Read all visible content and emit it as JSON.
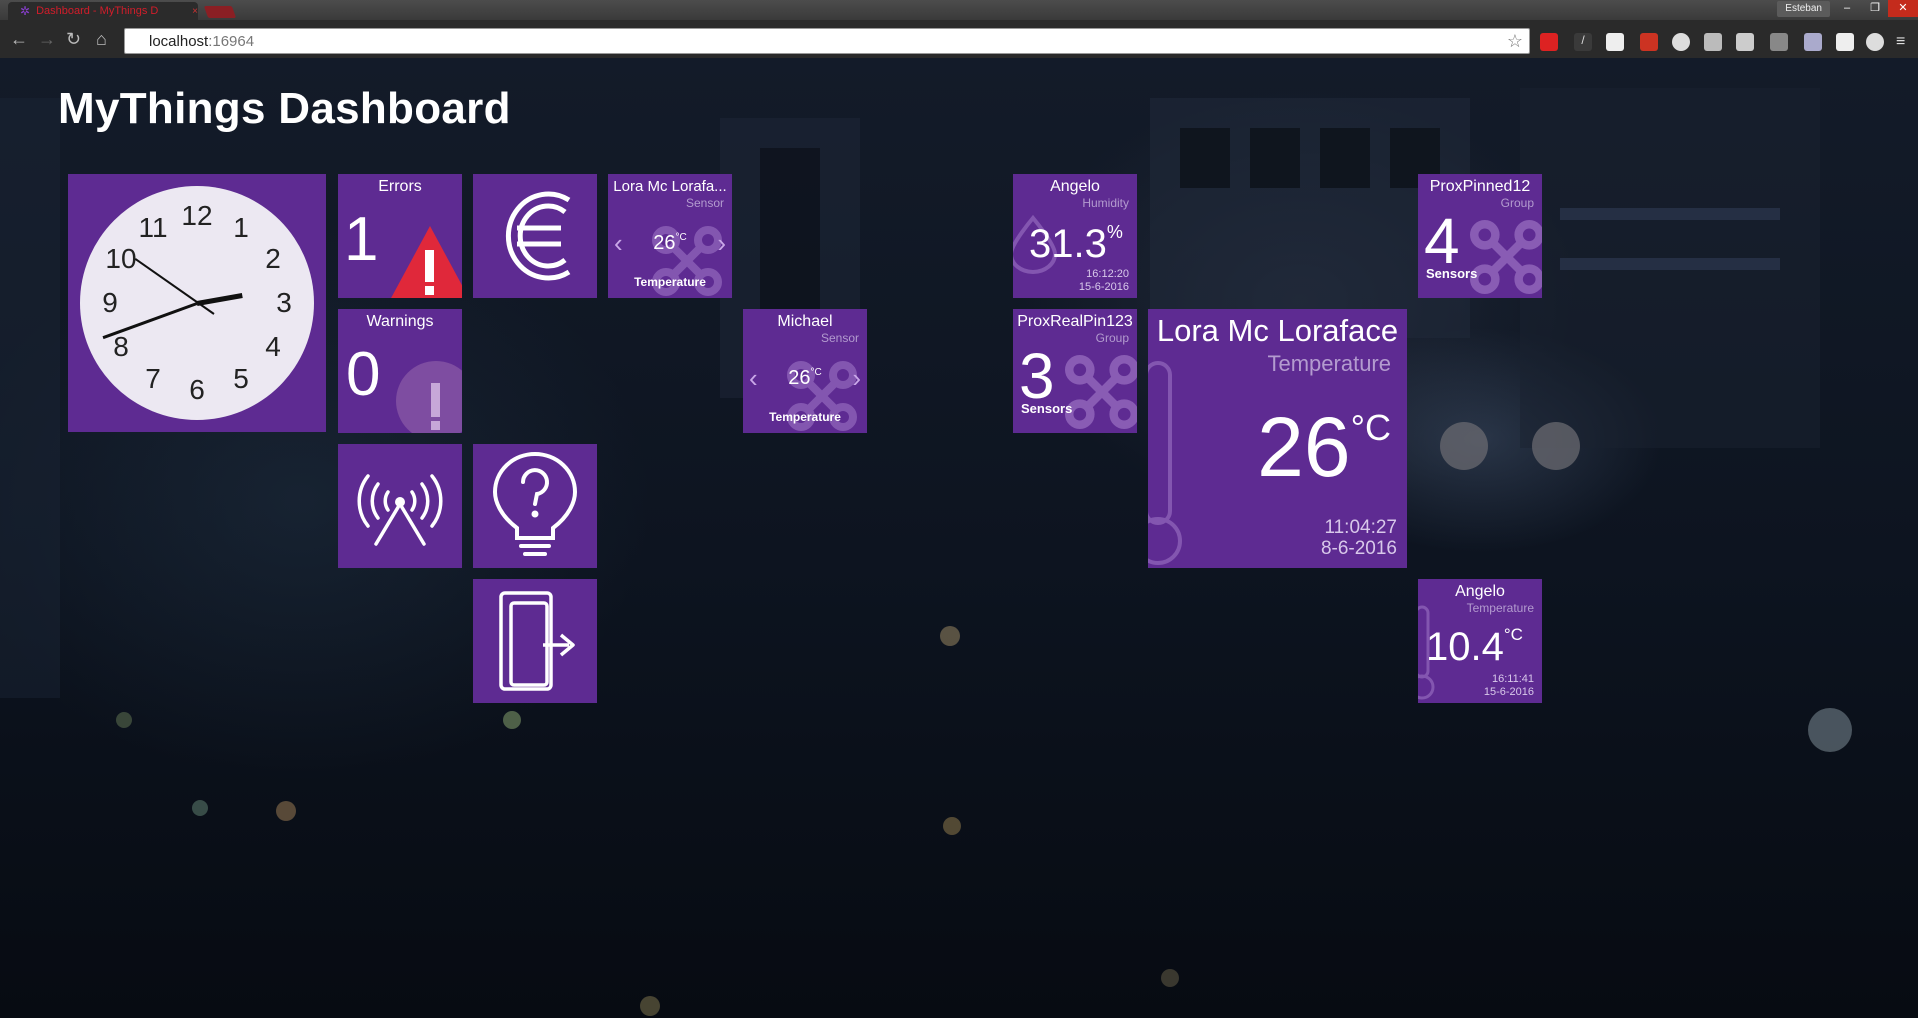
{
  "browser": {
    "tab_title": "Dashboard - MyThings D",
    "tab_close": "×",
    "url_host": "localhost",
    "url_port": ":16964",
    "user": "Esteban",
    "win_minimize": "–",
    "win_restore": "❐",
    "win_close": "✕"
  },
  "dashboard": {
    "title": "MyThings Dashboard",
    "clock": {
      "numbers": [
        "12",
        "1",
        "2",
        "3",
        "4",
        "5",
        "6",
        "7",
        "8",
        "9",
        "10",
        "11"
      ],
      "time": "2:50:40"
    },
    "errors": {
      "title": "Errors",
      "count": "1"
    },
    "warnings": {
      "title": "Warnings",
      "count": "0"
    },
    "sensor_lora": {
      "title": "Lora Mc Lorafa...",
      "type": "Sensor",
      "value": "26",
      "unit": "°C",
      "label": "Temperature"
    },
    "sensor_michael": {
      "title": "Michael",
      "type": "Sensor",
      "value": "26",
      "unit": "°C",
      "label": "Temperature"
    },
    "angelo_humidity": {
      "title": "Angelo",
      "type": "Humidity",
      "value": "31.3",
      "unit": "%",
      "time": "16:12:20",
      "date": "15-6-2016"
    },
    "prox_real": {
      "title": "ProxRealPin123",
      "type": "Group",
      "count": "3",
      "label": "Sensors"
    },
    "prox_pinned": {
      "title": "ProxPinned12",
      "type": "Group",
      "count": "4",
      "label": "Sensors"
    },
    "lora_large": {
      "title": "Lora Mc Loraface",
      "type": "Temperature",
      "value": "26",
      "unit": "°C",
      "time": "11:04:27",
      "date": "8-6-2016"
    },
    "angelo_temp": {
      "title": "Angelo",
      "type": "Temperature",
      "value": "10.4",
      "unit": "°C",
      "time": "16:11:41",
      "date": "15-6-2016"
    }
  },
  "colors": {
    "tile": "#5e2b92",
    "error": "#e0283a",
    "accent_text": "#b39bcf"
  },
  "icons": [
    "euro-icon",
    "antenna-icon",
    "help-bulb-icon",
    "logout-door-icon",
    "warning-triangle-icon",
    "exclamation-circle-icon",
    "chevron-left-icon",
    "chevron-right-icon",
    "sensor-group-icon",
    "thermometer-icon",
    "humidity-icon"
  ]
}
